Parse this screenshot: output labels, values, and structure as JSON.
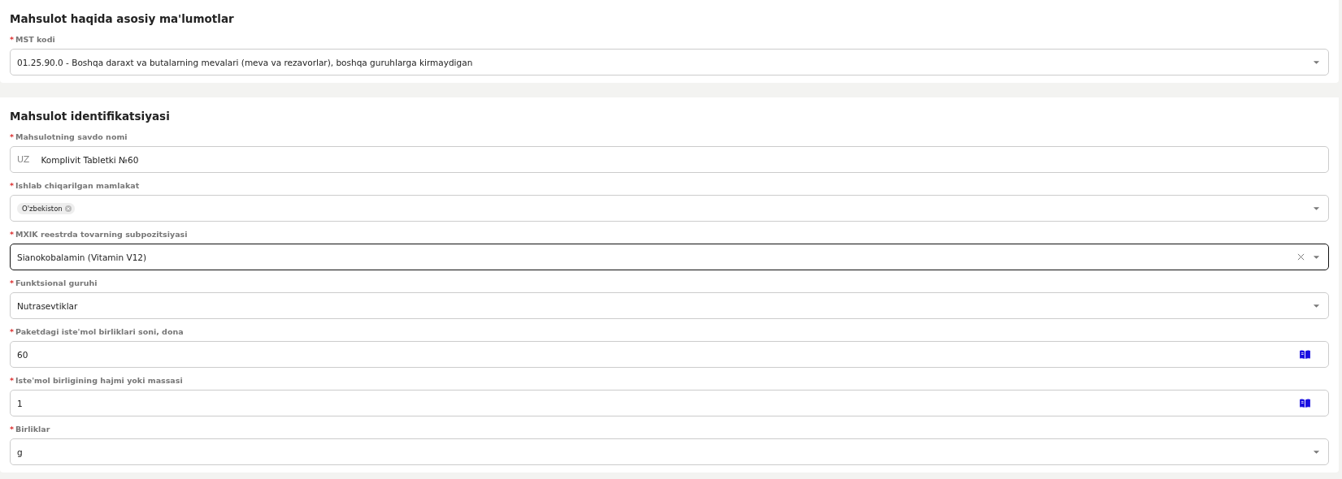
{
  "sections": [
    {
      "title": "Mahsulot haqida asosiy ma'lumotlar",
      "fields": [
        {
          "kind": "select",
          "label": "MST kodi",
          "required": "*",
          "focused": false,
          "value": "01.25.90.0 - Boshqa daraxt va butalarning mevalari (meva va rezavorlar), boshqa guruhlarga kirmaydigan"
        }
      ]
    },
    {
      "title": "Mahsulot identifikatsiyasi",
      "fields": [
        {
          "kind": "prefixed",
          "label": "Mahsulotning savdo nomi",
          "required": "*",
          "focused": false,
          "prefix": "UZ",
          "value": "Komplivit Tabletki №60"
        },
        {
          "kind": "tags",
          "label": "Ishlab chiqarilgan mamlakat",
          "required": "*",
          "focused": false,
          "tags": [
            "O'zbekiston"
          ]
        },
        {
          "kind": "select",
          "label": "MXIK reestrda tovarning subpozitsiyasi",
          "required": "*",
          "focused": true,
          "value": "Sianokobalamin (Vitamin V12)"
        },
        {
          "kind": "select",
          "label": "Funktsional guruhi",
          "required": "*",
          "focused": false,
          "value": "Nutrasevtiklar"
        },
        {
          "kind": "book",
          "label": "Paketdagi iste'mol birliklari soni, dona",
          "required": "*",
          "focused": false,
          "value": "60"
        },
        {
          "kind": "book",
          "label": "Iste'mol birligining hajmi yoki massasi",
          "required": "*",
          "focused": false,
          "value": "1"
        },
        {
          "kind": "select",
          "label": "Birliklar",
          "required": "*",
          "focused": false,
          "value": "g"
        }
      ]
    }
  ]
}
